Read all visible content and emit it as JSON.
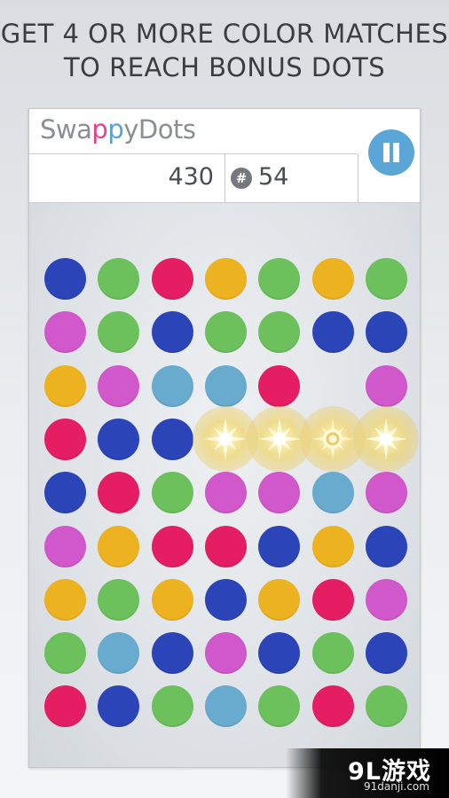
{
  "banner": {
    "line1": "GET 4 OR MORE COLOR MATCHES",
    "line2": "TO REACH BONUS DOTS"
  },
  "app": {
    "title_part1": "Swa",
    "title_p1": "p",
    "title_p2": "p",
    "title_part2": "yDots",
    "score": "430",
    "moves_icon": "#",
    "moves": "54",
    "pause_icon": "pause-icon"
  },
  "colors": {
    "blue": "#2b45b8",
    "green": "#6cc15c",
    "red": "#e51d62",
    "yellow": "#ecb220",
    "purple": "#d058cb",
    "lightblue": "#68abcf",
    "pause": "#5aa6d6",
    "bonus": "#f3d977"
  },
  "board": {
    "rows": [
      [
        "blue",
        "green",
        "red",
        "yellow",
        "green",
        "yellow",
        "green"
      ],
      [
        "purple",
        "green",
        "blue",
        "green",
        "green",
        "blue",
        "blue"
      ],
      [
        "yellow",
        "purple",
        "lightblue",
        "lightblue",
        "red",
        "",
        "purple"
      ],
      [
        "red",
        "blue",
        "blue",
        "bonus-star",
        "bonus-star",
        "bonus-ring",
        "bonus-star"
      ],
      [
        "blue",
        "red",
        "green",
        "purple",
        "purple",
        "lightblue",
        "purple"
      ],
      [
        "purple",
        "yellow",
        "red",
        "red",
        "blue",
        "yellow",
        "blue"
      ],
      [
        "yellow",
        "green",
        "yellow",
        "blue",
        "yellow",
        "red",
        "purple"
      ],
      [
        "green",
        "lightblue",
        "blue",
        "purple",
        "blue",
        "green",
        "blue"
      ],
      [
        "red",
        "blue",
        "green",
        "lightblue",
        "green",
        "red",
        "green"
      ]
    ]
  },
  "watermark": {
    "logo": "9L游戏",
    "site": "91danji.com"
  }
}
